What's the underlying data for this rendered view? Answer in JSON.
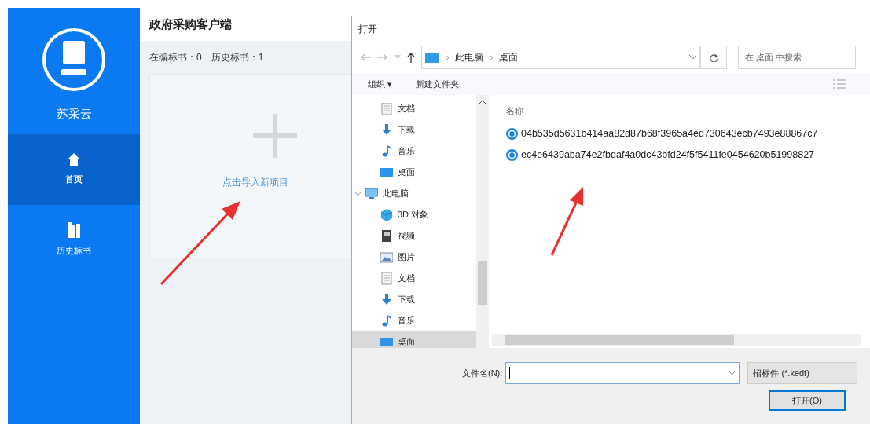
{
  "app": {
    "logo_text": "苏采云",
    "title": "政府采购客户端",
    "stats": [
      "在编标书：0",
      "历史标书：1"
    ],
    "import_link": "点击导入新项目"
  },
  "sidebar": {
    "items": [
      {
        "kind": "home",
        "label": "首页",
        "selected": true
      },
      {
        "kind": "history",
        "label": "历史标书",
        "selected": false
      }
    ]
  },
  "dialog": {
    "title": "打开",
    "address": {
      "path": [
        "此电脑",
        "桌面"
      ]
    },
    "search": {
      "placeholder": "在 桌面 中搜索"
    },
    "toolbar": [
      "组织 ▾",
      "新建文件夹"
    ],
    "nav_tree": [
      {
        "children": [
          {
            "kind": "docs",
            "label": "文档",
            "selected": false
          },
          {
            "kind": "download",
            "label": "下载",
            "selected": false
          },
          {
            "kind": "music",
            "label": "音乐",
            "selected": false
          },
          {
            "kind": "desktop",
            "label": "桌面",
            "selected": false
          }
        ]
      },
      {
        "kind": "pc",
        "label": "此电脑",
        "selected": false,
        "expanded": true,
        "children": [
          {
            "kind": "objects",
            "label": "3D 对象",
            "selected": false
          },
          {
            "kind": "video",
            "label": "视频",
            "selected": false
          },
          {
            "kind": "pictures",
            "label": "图片",
            "selected": false
          },
          {
            "kind": "docs",
            "label": "文档",
            "selected": false
          },
          {
            "kind": "download",
            "label": "下载",
            "selected": false
          },
          {
            "kind": "music",
            "label": "音乐",
            "selected": false
          },
          {
            "kind": "desktop",
            "label": "桌面",
            "selected": true
          }
        ]
      }
    ],
    "file_columns": [
      "名称"
    ],
    "files": [
      {
        "name": "04b535d5631b414aa82d87b68f3965a4ed730643ecb7493e88867c7"
      },
      {
        "name": "ec4e6439aba74e2fbdaf4a0dc43bfd24f5f5411fe0454620b51998827"
      }
    ],
    "filename_label": "文件名(N):",
    "filter": "招标件 (*.kedt)",
    "buttons": [
      "打开(O)"
    ]
  }
}
